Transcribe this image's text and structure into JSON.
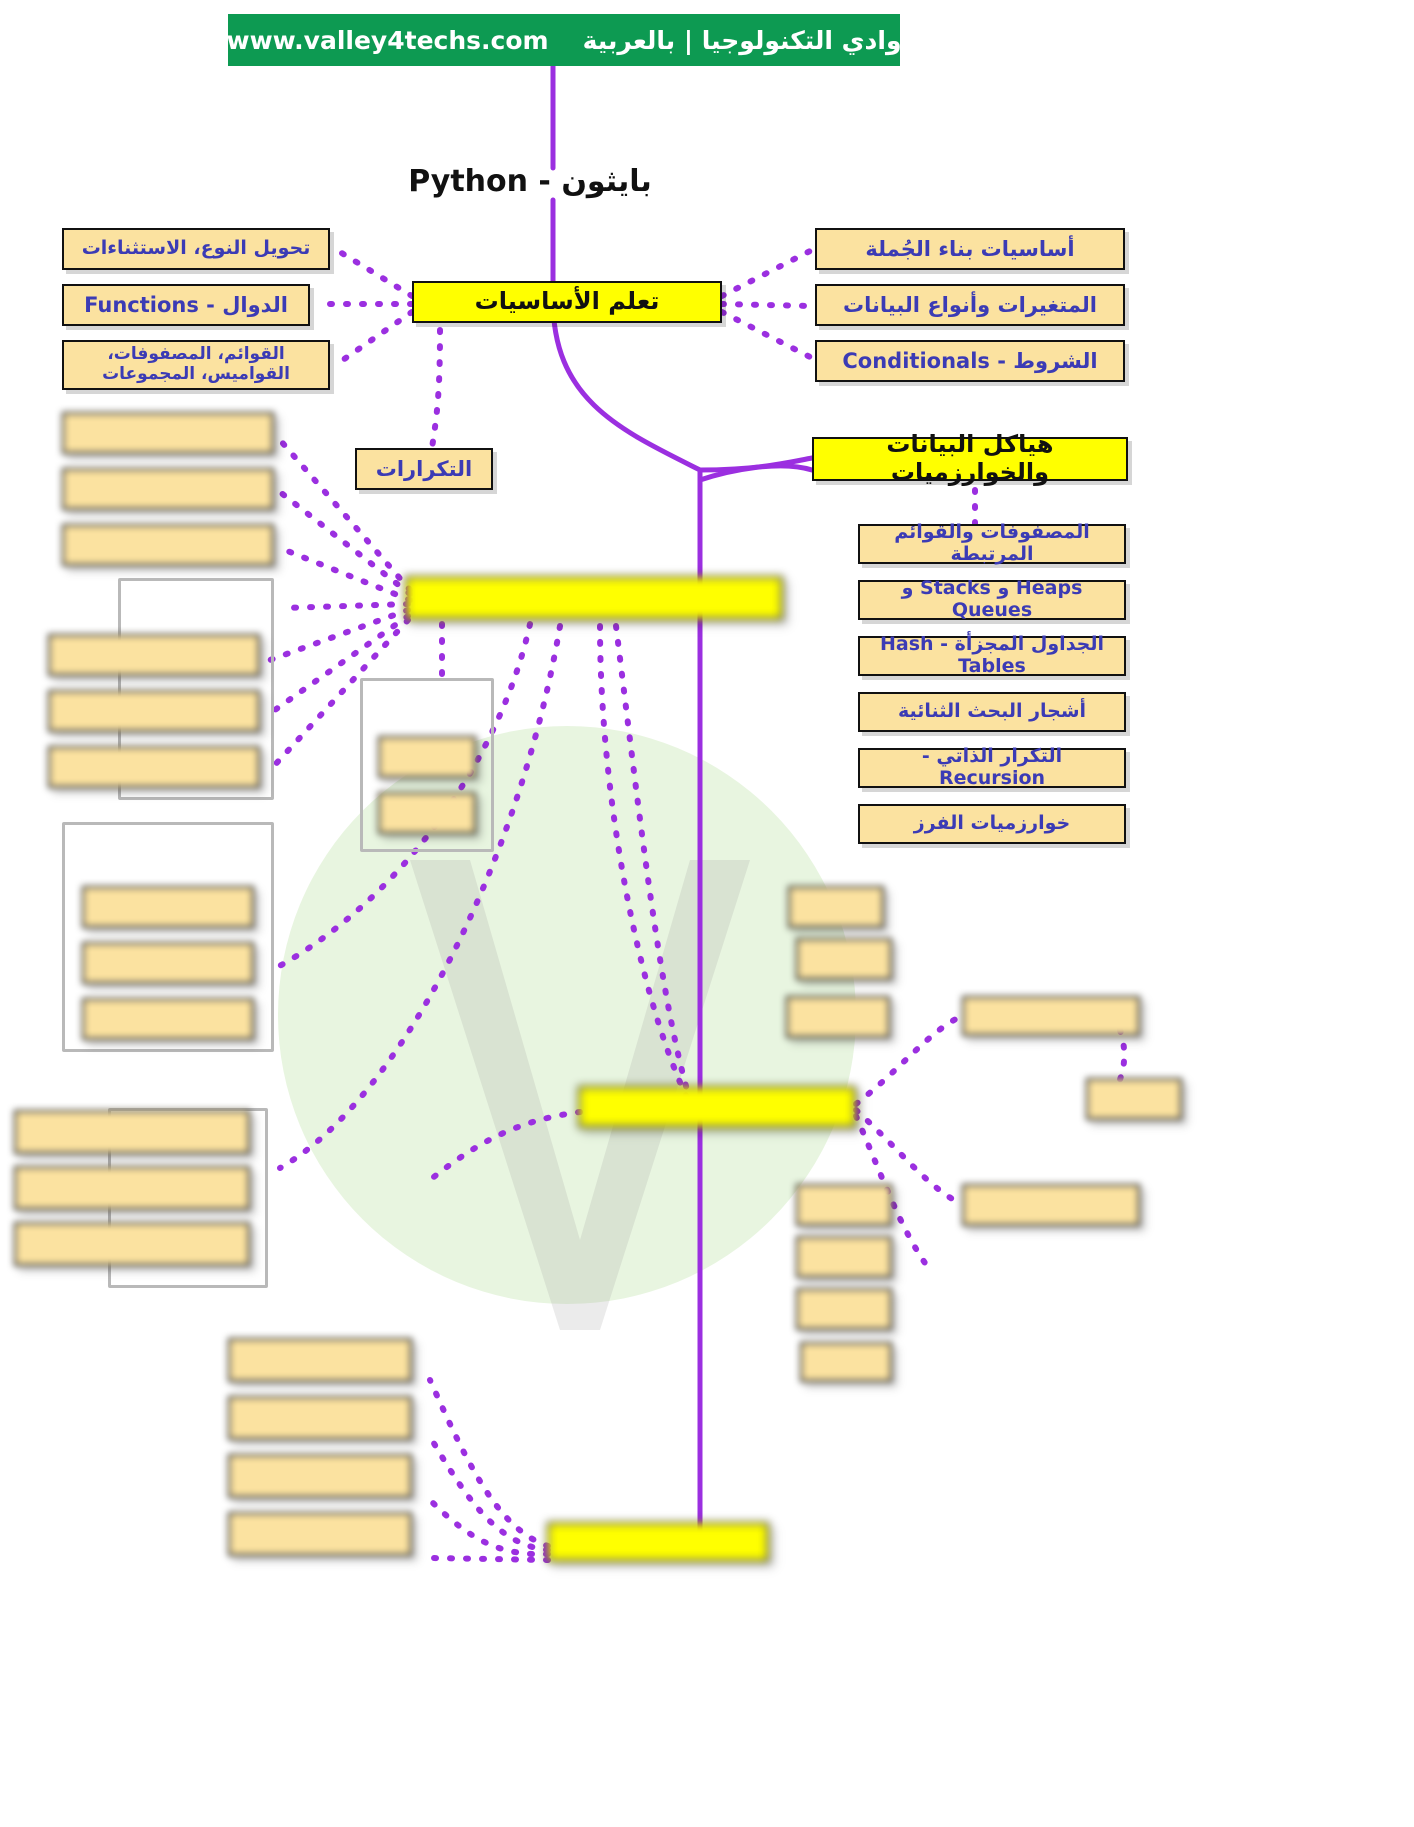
{
  "header": {
    "arabic": "وادي التكنولوجيا | بالعربية",
    "url": "www.valley4techs.com",
    "bg_color": "#0d9a52",
    "text_color": "#ffffff"
  },
  "root": {
    "title": "بايثون - Python"
  },
  "colors": {
    "node_fill": "#fbe2a0",
    "node_text": "#3b3bb5",
    "highlight_fill": "#ffff00",
    "highlight_text": "#111111",
    "alert_text": "#e8452c",
    "connector": "#9b2fe0",
    "backdrop_circle": "#e8f5e0"
  },
  "branches": {
    "basics": {
      "label": "تعلم الأساسيات",
      "left_children": [
        {
          "label": "تحويل النوع، الاستثناءات"
        },
        {
          "label": "الدوال - Functions"
        },
        {
          "label": "القوائم، المصفوفات، القواميس، المجموعات"
        },
        {
          "label": "التكرارات"
        }
      ],
      "right_children": [
        {
          "label": "أساسيات بناء الجُملة"
        },
        {
          "label": "المتغيرات وأنواع البيانات"
        },
        {
          "label": "الشروط - Conditionals"
        }
      ]
    },
    "dsa": {
      "label": "هياكل البيانات والخوارزميات",
      "children": [
        {
          "label": "المصفوفات والقوائم المرتبطة"
        },
        {
          "label": "Heaps و Stacks و Queues"
        },
        {
          "label": "الجداول المجزأة - Hash Tables"
        },
        {
          "label": "أشجار البحث الثنائية"
        },
        {
          "label": "التكرار الذاتي - Recursion"
        },
        {
          "label": "خوارزميات الفرز"
        }
      ]
    },
    "hidden_mid": {
      "label": "",
      "redacted": true
    },
    "hidden_lower": {
      "label": "",
      "redacted": true
    },
    "hidden_bottom": {
      "label": "",
      "redacted": true
    }
  },
  "redacted_groups": [
    {
      "name": "left-group-1",
      "items": [
        {
          "label": ""
        },
        {
          "label": ""
        },
        {
          "label": ""
        }
      ]
    },
    {
      "name": "left-group-2",
      "title": "",
      "items": [
        {
          "label": ""
        },
        {
          "label": ""
        },
        {
          "label": ""
        }
      ]
    },
    {
      "name": "left-group-3",
      "title": "",
      "items": [
        {
          "label": ""
        },
        {
          "label": ""
        },
        {
          "label": ""
        }
      ]
    },
    {
      "name": "left-group-4",
      "items": [
        {
          "label": ""
        },
        {
          "label": ""
        },
        {
          "label": ""
        }
      ]
    },
    {
      "name": "center-group",
      "title": "",
      "items": [
        {
          "label": ""
        },
        {
          "label": ""
        }
      ]
    },
    {
      "name": "right-group-upper",
      "items": [
        {
          "label": ""
        },
        {
          "label": ""
        },
        {
          "label": ""
        }
      ]
    },
    {
      "name": "right-group-lower",
      "items": [
        {
          "label": ""
        },
        {
          "label": ""
        },
        {
          "label": ""
        },
        {
          "label": ""
        }
      ]
    },
    {
      "name": "bottom-group",
      "items": [
        {
          "label": ""
        },
        {
          "label": ""
        },
        {
          "label": ""
        },
        {
          "label": ""
        }
      ]
    },
    {
      "name": "right-orange",
      "items": [
        {
          "label": ""
        },
        {
          "label": ""
        }
      ]
    },
    {
      "name": "far-right-small",
      "items": [
        {
          "label": ""
        }
      ]
    }
  ]
}
